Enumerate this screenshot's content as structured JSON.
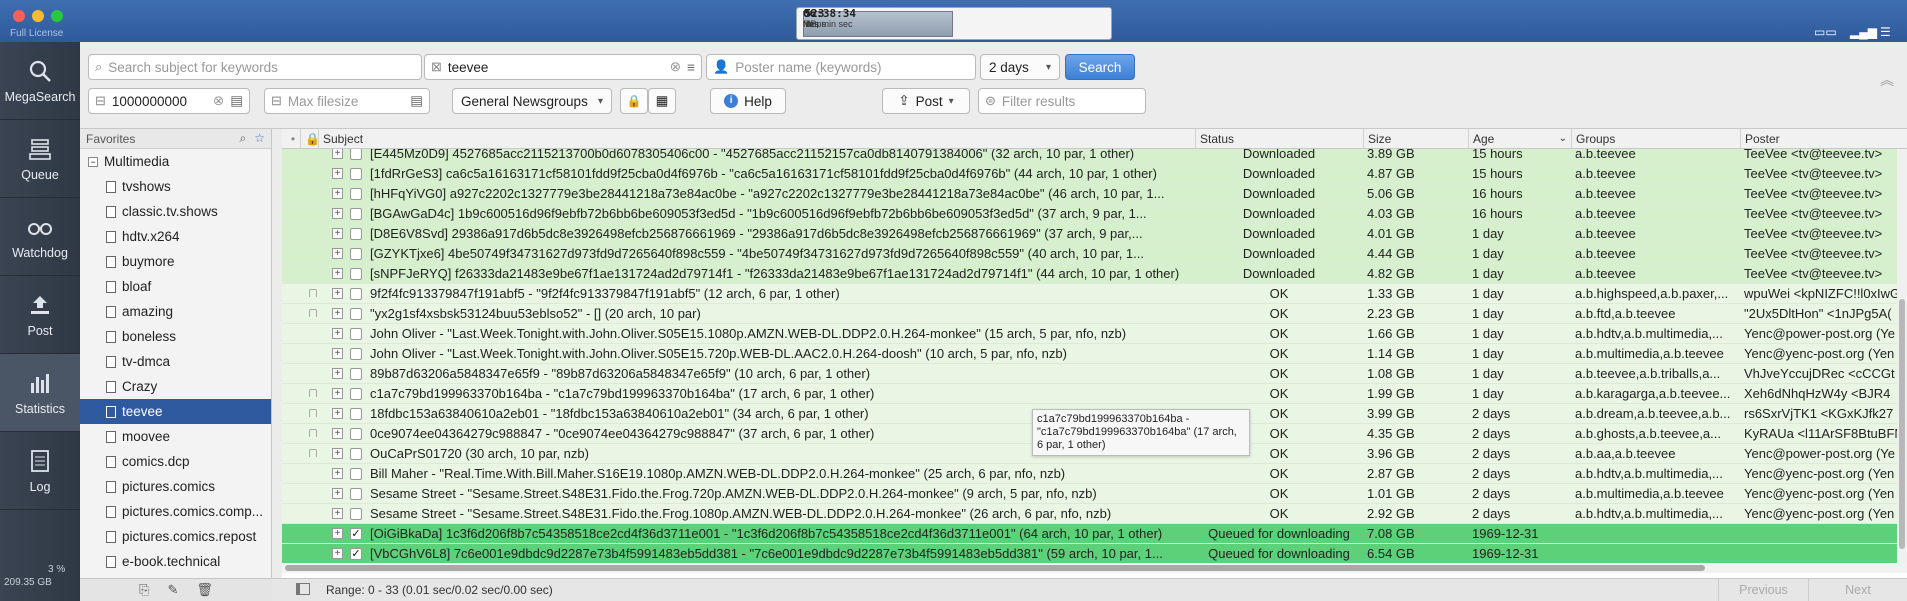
{
  "window": {
    "license": "Full License"
  },
  "meter": {
    "speed": "5.3",
    "speed_unit": "MBps",
    "files": "52",
    "files_unit": "files",
    "eta": "06:38:34",
    "eta_units": "hrs  min  sec"
  },
  "nav": [
    {
      "label": "MegaSearch",
      "icon": "search-icon"
    },
    {
      "label": "Queue",
      "icon": "queue-icon"
    },
    {
      "label": "Watchdog",
      "icon": "binoculars-icon"
    },
    {
      "label": "Post",
      "icon": "upload-icon"
    },
    {
      "label": "Statistics",
      "icon": "chart-icon"
    },
    {
      "label": "Log",
      "icon": "log-icon"
    }
  ],
  "disk": {
    "percent": "3 %",
    "free": "209.35 GB"
  },
  "search": {
    "subject_placeholder": "Search subject for keywords",
    "group_value": "teevee",
    "poster_placeholder": "Poster name (keywords)",
    "age_value": "2 days",
    "search_button": "Search",
    "min_size_value": "1000000000",
    "max_size_placeholder": "Max filesize",
    "newsgroups_value": "General Newsgroups",
    "help_button": "Help",
    "post_button": "Post",
    "filter_placeholder": "Filter results"
  },
  "favorites": {
    "header": "Favorites",
    "group": "Multimedia",
    "items": [
      "tvshows",
      "classic.tv.shows",
      "hdtv.x264",
      "buymore",
      "bloaf",
      "amazing",
      "boneless",
      "tv-dmca",
      "Crazy",
      "teevee",
      "moovee",
      "comics.dcp",
      "pictures.comics",
      "pictures.comics.comp...",
      "pictures.comics.repost",
      "e-book.technical"
    ],
    "selected": "teevee"
  },
  "columns": {
    "subject": "Subject",
    "status": "Status",
    "size": "Size",
    "age": "Age",
    "groups": "Groups",
    "poster": "Poster"
  },
  "rows": [
    {
      "kind": "dl",
      "lock": false,
      "checked": false,
      "subject": "[E445Mz0D9] 4527685acc2115213700b0d6078305406c00 - \"4527685acc21152157ca0db8140791384006\" (32 arch, 10 par, 1 other)",
      "status": "Downloaded",
      "size": "3.89 GB",
      "age": "15 hours",
      "groups": "a.b.teevee",
      "poster": "TeeVee <tv@teevee.tv>"
    },
    {
      "kind": "dl",
      "lock": false,
      "checked": false,
      "subject": "[1fdRrGeS3] ca6c5a16163171cf58101fdd9f25cba0d4f6976b - \"ca6c5a16163171cf58101fdd9f25cba0d4f6976b\" (44 arch, 10 par, 1 other)",
      "status": "Downloaded",
      "size": "4.87 GB",
      "age": "15 hours",
      "groups": "a.b.teevee",
      "poster": "TeeVee <tv@teevee.tv>"
    },
    {
      "kind": "dl",
      "lock": false,
      "checked": false,
      "subject": "[hHFqYiVG0] a927c2202c1327779e3be28441218a73e84ac0be - \"a927c2202c1327779e3be28441218a73e84ac0be\" (46 arch, 10 par, 1...",
      "status": "Downloaded",
      "size": "5.06 GB",
      "age": "16 hours",
      "groups": "a.b.teevee",
      "poster": "TeeVee <tv@teevee.tv>"
    },
    {
      "kind": "dl",
      "lock": false,
      "checked": false,
      "subject": "[BGAwGaD4c] 1b9c600516d96f9ebfb72b6bb6be609053f3ed5d - \"1b9c600516d96f9ebfb72b6bb6be609053f3ed5d\" (37 arch, 9 par, 1...",
      "status": "Downloaded",
      "size": "4.03 GB",
      "age": "16 hours",
      "groups": "a.b.teevee",
      "poster": "TeeVee <tv@teevee.tv>"
    },
    {
      "kind": "dl",
      "lock": false,
      "checked": false,
      "subject": "[D8E6V8Svd] 29386a917d6b5dc8e3926498efcb256876661969 - \"29386a917d6b5dc8e3926498efcb256876661969\" (37 arch, 9 par,...",
      "status": "Downloaded",
      "size": "4.01 GB",
      "age": "1 day",
      "groups": "a.b.teevee",
      "poster": "TeeVee <tv@teevee.tv>"
    },
    {
      "kind": "dl",
      "lock": false,
      "checked": false,
      "subject": "[GZYKTjxe6] 4be50749f34731627d973fd9d7265640f898c559 - \"4be50749f34731627d973fd9d7265640f898c559\" (40 arch, 10 par, 1...",
      "status": "Downloaded",
      "size": "4.44 GB",
      "age": "1 day",
      "groups": "a.b.teevee",
      "poster": "TeeVee <tv@teevee.tv>"
    },
    {
      "kind": "dl",
      "lock": false,
      "checked": false,
      "subject": "[sNPFJeRYQ] f26333da21483e9be67f1ae131724ad2d79714f1 - \"f26333da21483e9be67f1ae131724ad2d79714f1\" (44 arch, 10 par, 1 other)",
      "status": "Downloaded",
      "size": "4.82 GB",
      "age": "1 day",
      "groups": "a.b.teevee",
      "poster": "TeeVee <tv@teevee.tv>"
    },
    {
      "kind": "ok",
      "lock": true,
      "checked": false,
      "subject": "9f2f4fc913379847f191abf5 - \"9f2f4fc913379847f191abf5\" (12 arch, 6 par, 1 other)",
      "status": "OK",
      "size": "1.33 GB",
      "age": "1 day",
      "groups": "a.b.highspeed,a.b.paxer,...",
      "poster": "wpuWei <kpNIZFC!!l0xIwG"
    },
    {
      "kind": "ok",
      "lock": true,
      "checked": false,
      "subject": "\"yx2g1sf4xsbsk53124buu53eblso52\" - [] (20 arch, 10 par)",
      "status": "OK",
      "size": "2.23 GB",
      "age": "1 day",
      "groups": "a.b.ftd,a.b.teevee",
      "poster": "\"2Ux5DltHon\" <1nJPg5A("
    },
    {
      "kind": "ok",
      "lock": false,
      "checked": false,
      "subject": "John Oliver - \"Last.Week.Tonight.with.John.Oliver.S05E15.1080p.AMZN.WEB-DL.DDP2.0.H.264-monkee\" (15 arch, 5 par, nfo, nzb)",
      "status": "OK",
      "size": "1.66 GB",
      "age": "1 day",
      "groups": "a.b.hdtv,a.b.multimedia,...",
      "poster": "Yenc@power-post.org (Ye"
    },
    {
      "kind": "ok",
      "lock": false,
      "checked": false,
      "subject": "John Oliver - \"Last.Week.Tonight.with.John.Oliver.S05E15.720p.WEB-DL.AAC2.0.H.264-doosh\" (10 arch, 5 par, nfo, nzb)",
      "status": "OK",
      "size": "1.14 GB",
      "age": "1 day",
      "groups": "a.b.multimedia,a.b.teevee",
      "poster": "Yenc@yenc-post.org (Yen"
    },
    {
      "kind": "ok",
      "lock": false,
      "checked": false,
      "subject": "89b87d63206a5848347e65f9 - \"89b87d63206a5848347e65f9\" (10 arch, 6 par, 1 other)",
      "status": "OK",
      "size": "1.08 GB",
      "age": "1 day",
      "groups": "a.b.teevee,a.b.triballs,a...",
      "poster": "VhJveYccujDRec <cCCGt"
    },
    {
      "kind": "ok",
      "lock": true,
      "checked": false,
      "subject": "c1a7c79bd199963370b164ba - \"c1a7c79bd199963370b164ba\" (17 arch, 6 par, 1 other)",
      "status": "OK",
      "size": "1.99 GB",
      "age": "1 day",
      "groups": "a.b.karagarga,a.b.teevee...",
      "poster": "Xeh6dNhqHzW4y <BJR4"
    },
    {
      "kind": "ok",
      "lock": true,
      "checked": false,
      "subject": "18fdbc153a63840610a2eb01 - \"18fdbc153a63840610a2eb01\" (34 arch, 6 par, 1 other)",
      "status": "OK",
      "size": "3.99 GB",
      "age": "2 days",
      "groups": "a.b.dream,a.b.teevee,a.b...",
      "poster": "rs6SxrVjTK1 <KGxKJfk27"
    },
    {
      "kind": "ok",
      "lock": true,
      "checked": false,
      "subject": "0ce9074ee04364279c988847 - \"0ce9074ee04364279c988847\" (37 arch, 6 par, 1 other)",
      "status": "OK",
      "size": "4.35 GB",
      "age": "2 days",
      "groups": "a.b.ghosts,a.b.teevee,a...",
      "poster": "KyRAUa <l11ArSF8BtuBFN"
    },
    {
      "kind": "ok",
      "lock": true,
      "checked": false,
      "subject": "OuCaPrS01720 (30 arch, 10 par, nzb)",
      "status": "OK",
      "size": "3.96 GB",
      "age": "2 days",
      "groups": "a.b.aa,a.b.teevee",
      "poster": "Yenc@power-post.org (Ye"
    },
    {
      "kind": "ok",
      "lock": false,
      "checked": false,
      "subject": "Bill Maher - \"Real.Time.With.Bill.Maher.S16E19.1080p.AMZN.WEB-DL.DDP2.0.H.264-monkee\" (25 arch, 6 par, nfo, nzb)",
      "status": "OK",
      "size": "2.87 GB",
      "age": "2 days",
      "groups": "a.b.hdtv,a.b.multimedia,...",
      "poster": "Yenc@yenc-post.org (Yen"
    },
    {
      "kind": "ok",
      "lock": false,
      "checked": false,
      "subject": "Sesame Street - \"Sesame.Street.S48E31.Fido.the.Frog.720p.AMZN.WEB-DL.DDP2.0.H.264-monkee\" (9 arch, 5 par, nfo, nzb)",
      "status": "OK",
      "size": "1.01 GB",
      "age": "2 days",
      "groups": "a.b.multimedia,a.b.teevee",
      "poster": "Yenc@yenc-post.org (Yen"
    },
    {
      "kind": "ok",
      "lock": false,
      "checked": false,
      "subject": "Sesame Street - \"Sesame.Street.S48E31.Fido.the.Frog.1080p.AMZN.WEB-DL.DDP2.0.H.264-monkee\" (26 arch, 6 par, nfo, nzb)",
      "status": "OK",
      "size": "2.92 GB",
      "age": "2 days",
      "groups": "a.b.hdtv,a.b.multimedia,...",
      "poster": "Yenc@yenc-post.org (Yen"
    },
    {
      "kind": "q",
      "lock": false,
      "checked": true,
      "subject": "[OiGiBkaDa] 1c3f6d206f8b7c54358518ce2cd4f36d3711e001 - \"1c3f6d206f8b7c54358518ce2cd4f36d3711e001\" (64 arch, 10 par, 1 other)",
      "status": "Queued for downloading",
      "size": "7.08 GB",
      "age": "1969-12-31",
      "groups": "",
      "poster": ""
    },
    {
      "kind": "q",
      "lock": false,
      "checked": true,
      "subject": "[VbCGhV6L8] 7c6e001e9dbdc9d2287e73b4f5991483eb5dd381 - \"7c6e001e9dbdc9d2287e73b4f5991483eb5dd381\" (59 arch, 10 par, 1...",
      "status": "Queued for downloading",
      "size": "6.54 GB",
      "age": "1969-12-31",
      "groups": "",
      "poster": ""
    }
  ],
  "tooltip": {
    "text": "c1a7c79bd199963370b164ba - \"c1a7c79bd199963370b164ba\" (17 arch, 6 par, 1 other)"
  },
  "status_bar": {
    "range": "Range: 0 - 33 (0.01 sec/0.02 sec/0.00 sec)",
    "previous": "Previous",
    "next": "Next"
  }
}
